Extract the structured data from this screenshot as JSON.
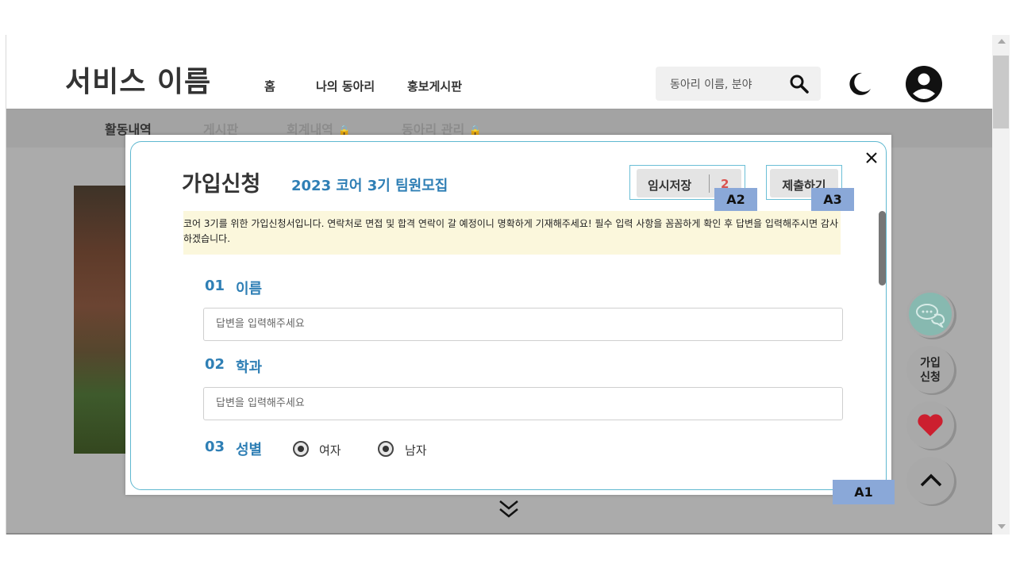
{
  "header": {
    "brand": "서비스 이름",
    "nav": [
      "홈",
      "나의 동아리",
      "홍보게시판"
    ],
    "search_placeholder": "동아리 이름, 분야"
  },
  "subnav": {
    "tabs": [
      "활동내역",
      "게시판",
      "회계내역",
      "동아리 관리"
    ]
  },
  "fab": {
    "join_line1": "가입",
    "join_line2": "신청"
  },
  "modal": {
    "title": "가입신청",
    "subtitle": "2023 코어 3기 팀원모집",
    "draft_label": "임시저장",
    "draft_count": "2",
    "submit_label": "제출하기",
    "notice": "코어 3기를 위한 가입신청서입니다. 연락처로 면접 및 합격 연락이 갈 예정이니 명확하게 기재해주세요! 필수 입력 사항을 꼼꼼하게 확인 후 답변을 입력해주시면 감사하겠습니다.",
    "questions": [
      {
        "num": "01",
        "label": "이름",
        "placeholder": "답변을 입력해주세요"
      },
      {
        "num": "02",
        "label": "학과",
        "placeholder": "답변을 입력해주세요"
      },
      {
        "num": "03",
        "label": "성별",
        "options": [
          "여자",
          "남자"
        ]
      }
    ]
  },
  "annotations": {
    "a1": "A1",
    "a2": "A2",
    "a3": "A3"
  },
  "colors": {
    "accent_blue": "#2f7fb5",
    "border_cyan": "#5fb8d0",
    "tag_blue": "#8aa8d8",
    "notice_bg": "#fbf7dc",
    "heart_red": "#cc1f2f",
    "draft_count_red": "#d9534f"
  }
}
